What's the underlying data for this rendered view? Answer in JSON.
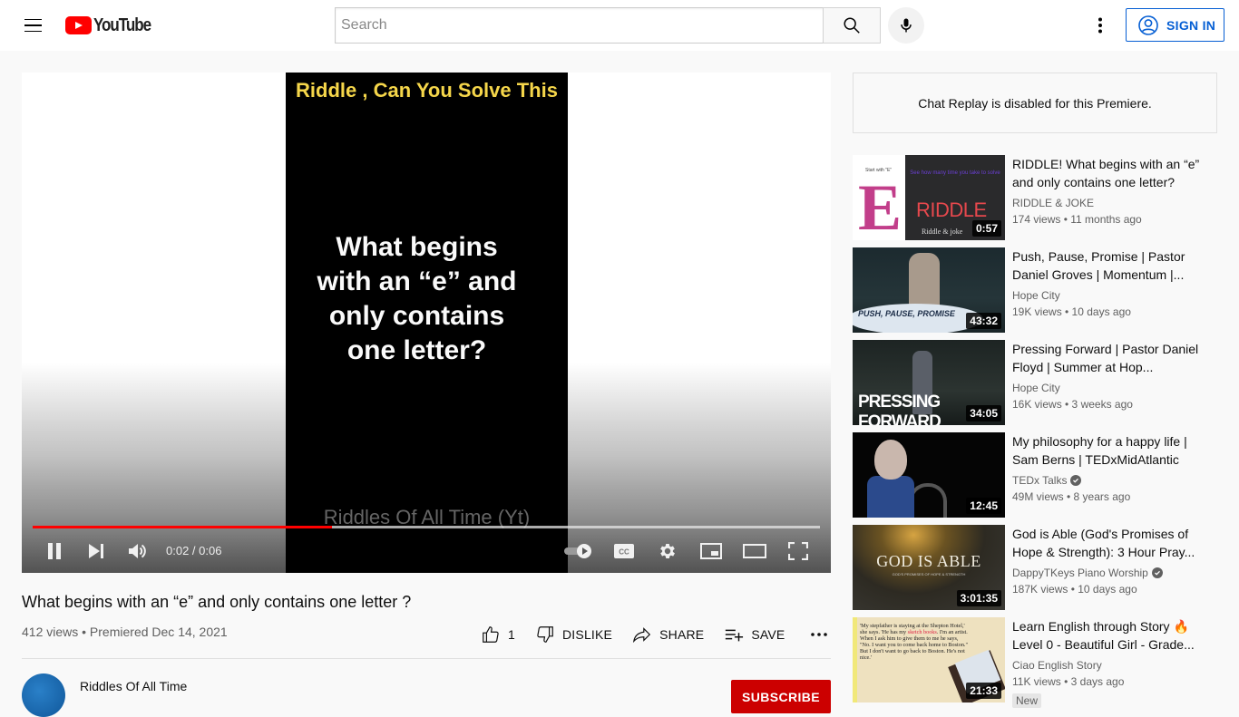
{
  "header": {
    "logo_text": "YouTube",
    "search_placeholder": "Search",
    "search_value": "",
    "sign_in_label": "SIGN IN"
  },
  "player": {
    "video_overlay_title": "Riddle , Can You Solve This",
    "video_overlay_question": "What begins with an “e” and only contains one letter?",
    "video_watermark": "Riddles Of All Time (Yt)",
    "time_current": "0:02",
    "time_total": "0:06",
    "time_display": "0:02 / 0:06",
    "progress_fraction": 0.38,
    "colors": {
      "progress": "#ff0000"
    }
  },
  "video": {
    "title": "What begins with an “e” and only contains one letter ?",
    "meta": "412 views • Premiered Dec 14, 2021",
    "like_count": "1",
    "dislike_label": "DISLIKE",
    "share_label": "SHARE",
    "save_label": "SAVE"
  },
  "channel": {
    "name": "Riddles Of All Time",
    "subscribe_label": "SUBSCRIBE",
    "colors": {
      "subscribe": "#cc0000"
    }
  },
  "sidebar": {
    "chat_message": "Chat Replay is disabled for this Premiere.",
    "recommendations": [
      {
        "title": "RIDDLE! What begins with an “e” and only contains one letter?",
        "channel": "RIDDLE & JOKE",
        "verified": false,
        "meta": "174 views • 11 months ago",
        "duration": "0:57",
        "thumb_text": {
          "small": "Start with \"E\"",
          "big_letter": "E",
          "prompt": "See how many time you take to solve",
          "word": "RIDDLE",
          "brand": "Riddle & joke"
        }
      },
      {
        "title": "Push, Pause, Promise | Pastor Daniel Groves | Momentum |...",
        "channel": "Hope City",
        "verified": false,
        "meta": "19K views • 10 days ago",
        "duration": "43:32",
        "thumb_text": {
          "overlay": "PUSH, PAUSE, PROMISE"
        }
      },
      {
        "title": "Pressing Forward | Pastor Daniel Floyd | Summer at Hop...",
        "channel": "Hope City",
        "verified": false,
        "meta": "16K views • 3 weeks ago",
        "duration": "34:05",
        "thumb_text": {
          "overlay": "PRESSING FORWARD"
        }
      },
      {
        "title": "My philosophy for a happy life | Sam Berns | TEDxMidAtlantic",
        "channel": "TEDx Talks",
        "verified": true,
        "meta": "49M views • 8 years ago",
        "duration": "12:45"
      },
      {
        "title": "God is Able (God's Promises of Hope & Strength): 3 Hour Pray...",
        "channel": "DappyTKeys Piano Worship",
        "verified": true,
        "meta": "187K views • 10 days ago",
        "duration": "3:01:35",
        "thumb_text": {
          "overlay": "GOD IS ABLE",
          "sub": "GOD'S PROMISES OF HOPE & STRENGTH"
        }
      },
      {
        "title": "Learn English through Story 🔥 Level 0 - Beautiful Girl - Grade...",
        "channel": "Ciao English Story",
        "verified": false,
        "meta": "11K views • 3 days ago",
        "duration": "21:33",
        "badge": "New",
        "thumb_text": {
          "p1": "'My stepfather is staying at the Shepton Hotel,' she says. 'He has my ",
          "highlight": "sketch books",
          "p2": ". I'm an artist. When I ask him to give them to me he says, \"No. I want you to come back home to Boston.\" But I don't want to go back to Boston. He's not nice.'"
        }
      }
    ]
  }
}
